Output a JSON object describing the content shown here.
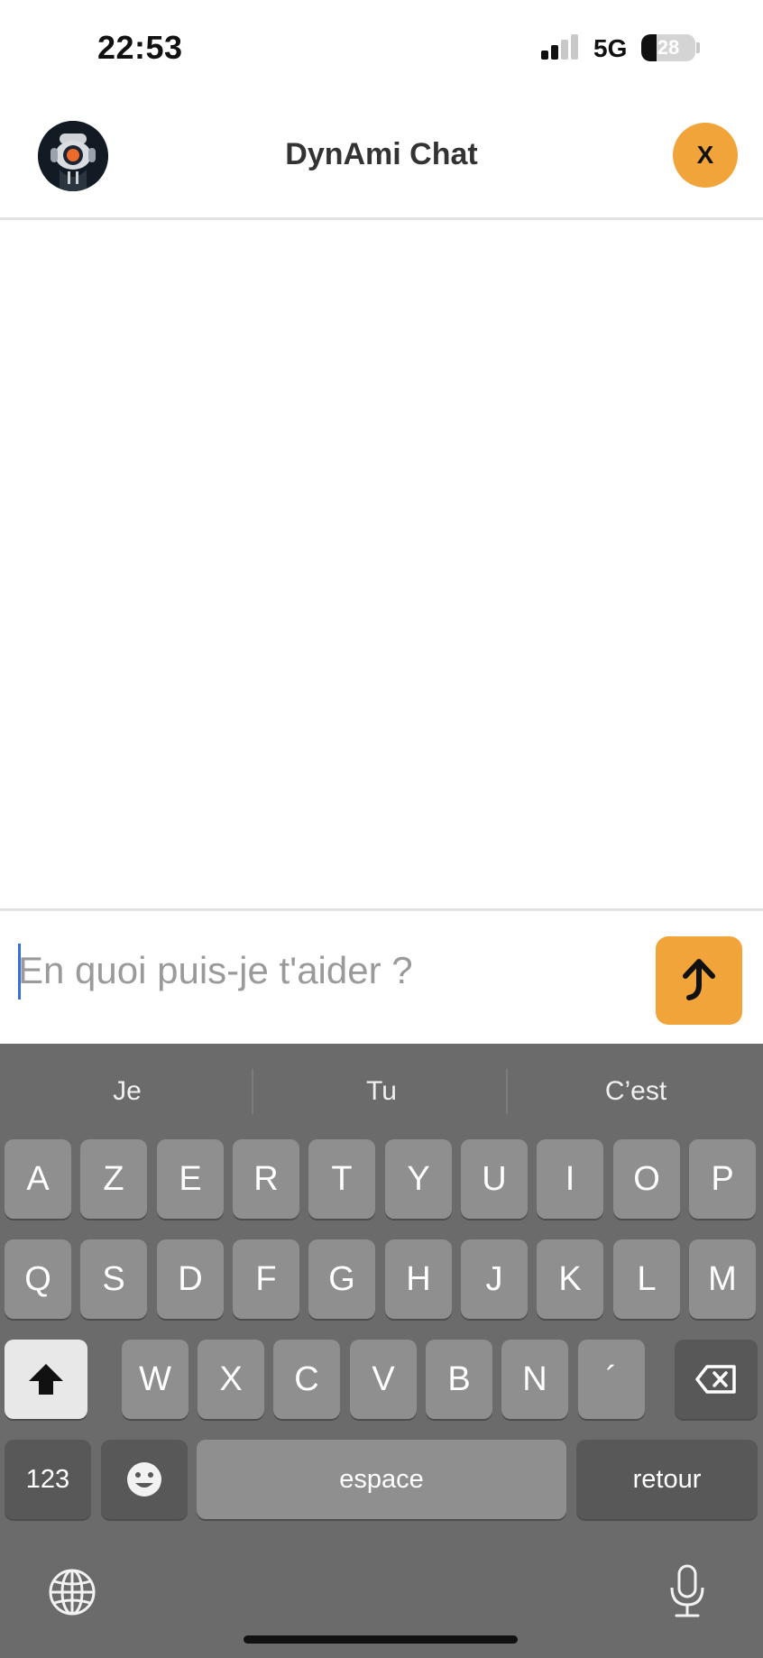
{
  "status_bar": {
    "time": "22:53",
    "network": "5G",
    "battery_level": "28"
  },
  "header": {
    "title": "DynAmi Chat",
    "close_label": "X"
  },
  "composer": {
    "placeholder": "En quoi puis-je t'aider ?"
  },
  "keyboard": {
    "suggestions": [
      "Je",
      "Tu",
      "C’est"
    ],
    "row1": [
      "A",
      "Z",
      "E",
      "R",
      "T",
      "Y",
      "U",
      "I",
      "O",
      "P"
    ],
    "row2": [
      "Q",
      "S",
      "D",
      "F",
      "G",
      "H",
      "J",
      "K",
      "L",
      "M"
    ],
    "row3": [
      "W",
      "X",
      "C",
      "V",
      "B",
      "N",
      "´"
    ],
    "numbers_label": "123",
    "space_label": "espace",
    "return_label": "retour"
  },
  "colors": {
    "accent": "#f1a43a",
    "keyboard_bg": "#6b6b6b",
    "key_bg": "#8f8f8f"
  },
  "icons": {
    "avatar": "robot-avatar-icon",
    "send": "arrow-up-icon",
    "shift": "shift-arrow-icon",
    "delete": "backspace-icon",
    "emoji": "smiley-icon",
    "language": "globe-icon",
    "dictation": "microphone-icon"
  }
}
